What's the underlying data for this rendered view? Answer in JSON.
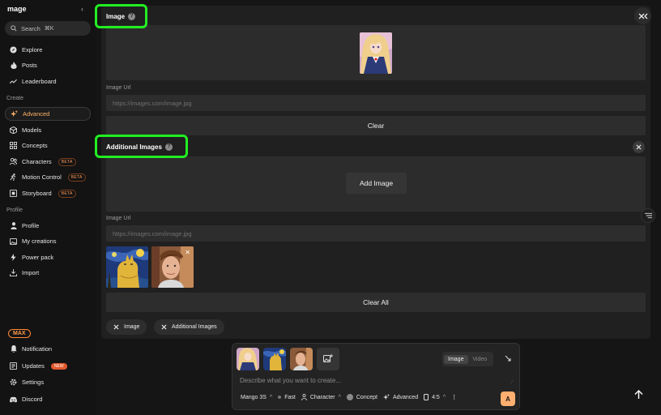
{
  "sidebar": {
    "logo": "mage",
    "search_label": "Search",
    "search_shortcut": "⌘K",
    "items_top": [
      {
        "label": "Explore",
        "icon": "compass-icon"
      },
      {
        "label": "Posts",
        "icon": "flame-icon"
      },
      {
        "label": "Leaderboard",
        "icon": "trend-icon"
      }
    ],
    "create_heading": "Create",
    "items_create": [
      {
        "label": "Advanced",
        "icon": "sparkle-icon",
        "active": true
      },
      {
        "label": "Models",
        "icon": "cube-icon"
      },
      {
        "label": "Concepts",
        "icon": "grid-icon"
      },
      {
        "label": "Characters",
        "icon": "people-icon",
        "badge": "BETA"
      },
      {
        "label": "Motion Control",
        "icon": "motion-icon",
        "badge": "BETA"
      },
      {
        "label": "Storyboard",
        "icon": "film-icon",
        "badge": "BETA"
      }
    ],
    "profile_heading": "Profile",
    "items_profile": [
      {
        "label": "Profile",
        "icon": "user-icon"
      },
      {
        "label": "My creations",
        "icon": "image-icon"
      },
      {
        "label": "Power pack",
        "icon": "bolt-icon"
      },
      {
        "label": "Import",
        "icon": "import-icon"
      }
    ],
    "max_badge": "MAX",
    "items_bottom": [
      {
        "label": "Notification",
        "icon": "bell-icon"
      },
      {
        "label": "Updates",
        "icon": "updates-icon",
        "badge": "NEW"
      },
      {
        "label": "Settings",
        "icon": "gear-icon"
      },
      {
        "label": "Discord",
        "icon": "discord-icon"
      }
    ]
  },
  "panel": {
    "image_section": {
      "title": "Image",
      "url_label": "Image Url",
      "url_placeholder": "https://images.com/image.jpg",
      "clear_label": "Clear"
    },
    "additional_section": {
      "title": "Additional Images",
      "add_label": "Add Image",
      "url_label": "Image Url",
      "url_placeholder": "https://images.com/image.jpg",
      "clear_all_label": "Clear All"
    },
    "chips": [
      "Image",
      "Additional Images"
    ]
  },
  "prompt": {
    "mode_tabs": [
      "Image",
      "Video"
    ],
    "active_mode": "Image",
    "placeholder": "Describe what you want to create...",
    "model": "Mango 3S",
    "speed": "Fast",
    "character": "Character",
    "concept": "Concept",
    "advanced": "Advanced",
    "aspect": "4:5",
    "generate_glyph": "A"
  },
  "colors": {
    "highlight": "#22ee22",
    "accent": "#ffb070",
    "active_nav_text": "#ffb36b"
  }
}
